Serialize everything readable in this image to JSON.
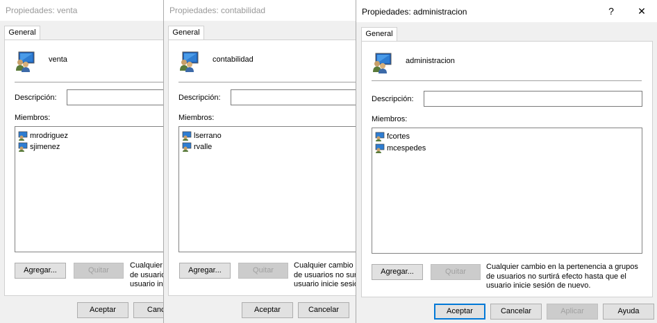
{
  "dialogs": [
    {
      "title": "Propiedades: venta",
      "tab": "General",
      "group_name": "venta",
      "description_label": "Descripción:",
      "description_value": "",
      "members_label": "Miembros:",
      "members": [
        "mrodriguez",
        "sjimenez"
      ],
      "add_button": "Agregar...",
      "remove_button": "Quitar",
      "note": [
        "Cualquier c",
        "de usuarios",
        "usuario inici"
      ],
      "ok_button": "Aceptar",
      "cancel_button": "Cancel"
    },
    {
      "title": "Propiedades: contabilidad",
      "tab": "General",
      "group_name": "contabilidad",
      "description_label": "Descripción:",
      "description_value": "",
      "members_label": "Miembros:",
      "members": [
        "lserrano",
        "rvalle"
      ],
      "add_button": "Agregar...",
      "remove_button": "Quitar",
      "note": [
        "Cualquier cambio e",
        "de usuarios no surtir",
        "usuario inicie sesión"
      ],
      "ok_button": "Aceptar",
      "cancel_button": "Cancelar"
    },
    {
      "title": "Propiedades: administracion",
      "help_button": "?",
      "close_button": "✕",
      "tab": "General",
      "group_name": "administracion",
      "description_label": "Descripción:",
      "description_value": "",
      "members_label": "Miembros:",
      "members": [
        "fcortes",
        "mcespedes"
      ],
      "add_button": "Agregar...",
      "remove_button": "Quitar",
      "note": [
        "Cualquier cambio en la pertenencia a grupos",
        "de usuarios no surtirá efecto hasta que el",
        "usuario inicie sesión de nuevo."
      ],
      "ok_button": "Aceptar",
      "cancel_button": "Cancelar",
      "apply_button": "Aplicar",
      "help_text_button": "Ayuda"
    }
  ]
}
